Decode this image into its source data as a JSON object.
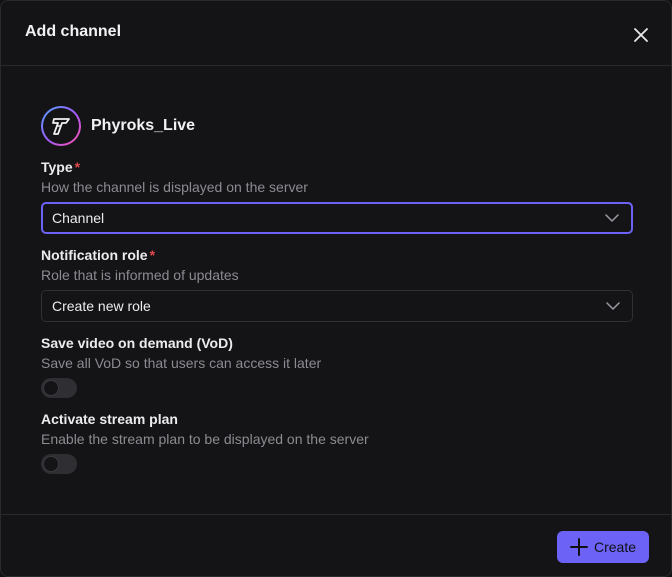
{
  "dialog": {
    "title": "Add channel"
  },
  "channel": {
    "name": "Phyroks_Live",
    "avatar_icon": "phyroks-logo-icon"
  },
  "fields": {
    "type": {
      "label": "Type",
      "required_mark": "*",
      "description": "How the channel is displayed on the server",
      "value": "Channel"
    },
    "notification_role": {
      "label": "Notification role",
      "required_mark": "*",
      "description": "Role that is informed of updates",
      "value": "Create new role"
    },
    "vod": {
      "label": "Save video on demand (VoD)",
      "description": "Save all VoD so that users can access it later",
      "enabled": false
    },
    "stream_plan": {
      "label": "Activate stream plan",
      "description": "Enable the stream plan to be displayed on the server",
      "enabled": false
    }
  },
  "footer": {
    "create_label": "Create"
  },
  "colors": {
    "accent": "#6c63f6",
    "required": "#e5484d",
    "background": "#141416",
    "muted_text": "#8b8b92"
  }
}
